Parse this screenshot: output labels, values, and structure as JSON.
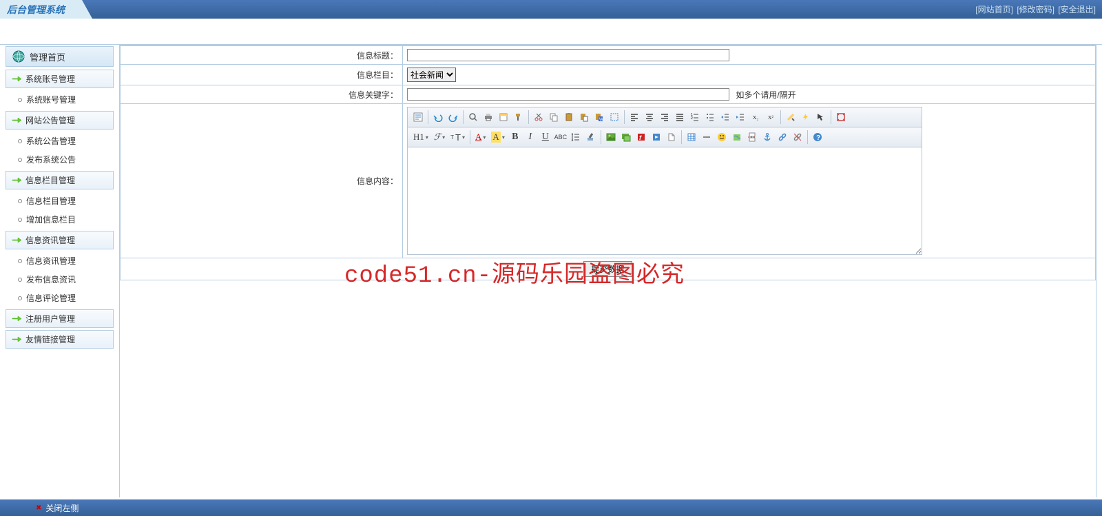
{
  "header": {
    "logo": "后台管理系统",
    "links": {
      "home": "[网站首页]",
      "pwd": "[修改密码]",
      "exit": "[安全退出]"
    }
  },
  "sidebar": {
    "top": "管理首页",
    "groups": [
      {
        "title": "系统账号管理",
        "items": [
          "系统账号管理"
        ]
      },
      {
        "title": "网站公告管理",
        "items": [
          "系统公告管理",
          "发布系统公告"
        ]
      },
      {
        "title": "信息栏目管理",
        "items": [
          "信息栏目管理",
          "增加信息栏目"
        ]
      },
      {
        "title": "信息资讯管理",
        "items": [
          "信息资讯管理",
          "发布信息资讯",
          "信息评论管理"
        ]
      },
      {
        "title": "注册用户管理",
        "items": []
      },
      {
        "title": "友情链接管理",
        "items": []
      }
    ]
  },
  "form": {
    "title_label": "信息标题：",
    "column_label": "信息栏目：",
    "column_selected": "社会新闻",
    "keyword_label": "信息关键字：",
    "keyword_hint": "如多个请用/隔开",
    "content_label": "信息内容：",
    "submit": "提交数据"
  },
  "editor": {
    "h1": "H1",
    "font_family": "ℱ",
    "font_size": "тT",
    "font_color": "A",
    "bg_color": "A",
    "bold": "B",
    "italic": "I",
    "underline": "U"
  },
  "footer": {
    "close": "关闭左侧"
  },
  "watermark": "code51.cn-源码乐园盗图必究"
}
